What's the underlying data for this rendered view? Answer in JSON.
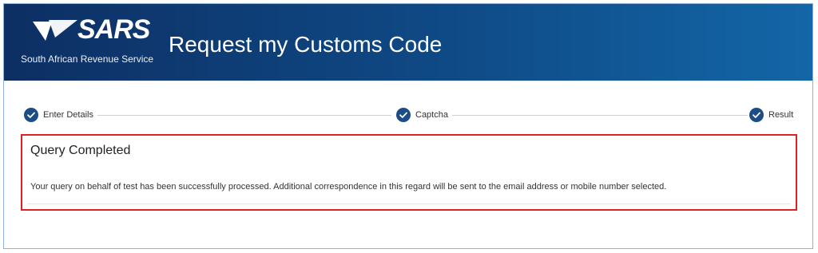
{
  "header": {
    "logo_text": "SARS",
    "logo_subtitle": "South African Revenue Service",
    "title": "Request my Customs Code",
    "colors": {
      "banner_left": "#0d2f63",
      "banner_right": "#1366a7"
    }
  },
  "stepper": {
    "steps": [
      {
        "label": "Enter Details",
        "status": "complete"
      },
      {
        "label": "Captcha",
        "status": "complete"
      },
      {
        "label": "Result",
        "status": "complete"
      }
    ],
    "accent": "#1c4d86"
  },
  "result": {
    "heading": "Query Completed",
    "message": "Your query on behalf of test has been successfully processed. Additional correspondence in this regard will be sent to the email address or mobile number selected.",
    "highlight_color": "#e02020"
  }
}
